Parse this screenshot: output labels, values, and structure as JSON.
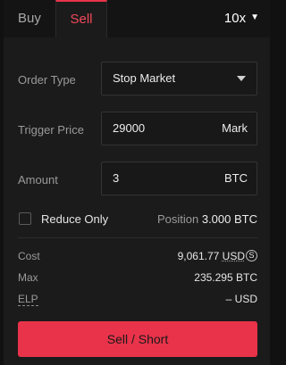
{
  "tabs": {
    "buy": "Buy",
    "sell": "Sell",
    "active": "sell"
  },
  "leverage": {
    "value": "10x"
  },
  "order_type": {
    "label": "Order Type",
    "value": "Stop Market"
  },
  "trigger_price": {
    "label": "Trigger Price",
    "value": "29000",
    "suffix": "Mark"
  },
  "amount": {
    "label": "Amount",
    "value": "3",
    "suffix": "BTC"
  },
  "reduce_only": {
    "label": "Reduce Only",
    "checked": false
  },
  "position": {
    "label": "Position",
    "value": "3.000 BTC"
  },
  "cost": {
    "label": "Cost",
    "value": "9,061.77",
    "unit": "USD",
    "icon": "S"
  },
  "max": {
    "label": "Max",
    "value": "235.295 BTC"
  },
  "elp": {
    "label": "ELP",
    "value": "– USD"
  },
  "submit": {
    "label": "Sell / Short"
  },
  "colors": {
    "accent": "#e8334a",
    "background": "#1b1b1b"
  }
}
